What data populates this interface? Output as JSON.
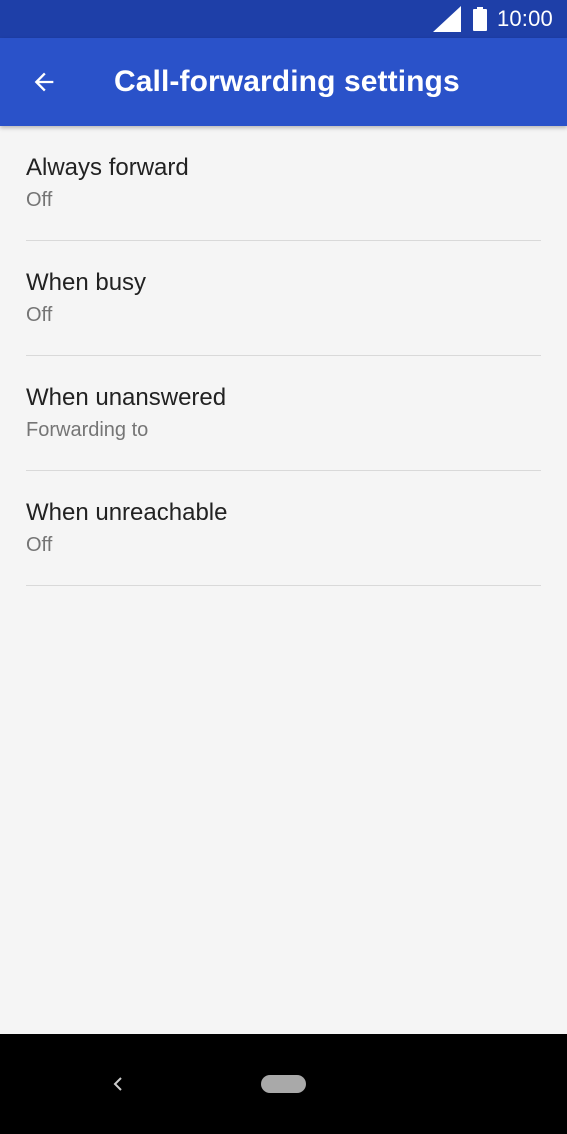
{
  "status_bar": {
    "time": "10:00",
    "icons": [
      "signal-icon",
      "battery-icon"
    ]
  },
  "app_bar": {
    "title": "Call-forwarding settings",
    "back_icon": "arrow-back-icon"
  },
  "settings": [
    {
      "title": "Always forward",
      "subtitle": "Off"
    },
    {
      "title": "When busy",
      "subtitle": "Off"
    },
    {
      "title": "When unanswered",
      "subtitle": "Forwarding to"
    },
    {
      "title": "When unreachable",
      "subtitle": "Off"
    }
  ],
  "nav_bar": {
    "back_icon": "nav-back-icon",
    "home_icon": "home-pill-icon"
  },
  "colors": {
    "status_bar": "#1e3fa8",
    "app_bar": "#2a52c9",
    "background": "#f5f5f5",
    "nav_bar": "#000000"
  }
}
